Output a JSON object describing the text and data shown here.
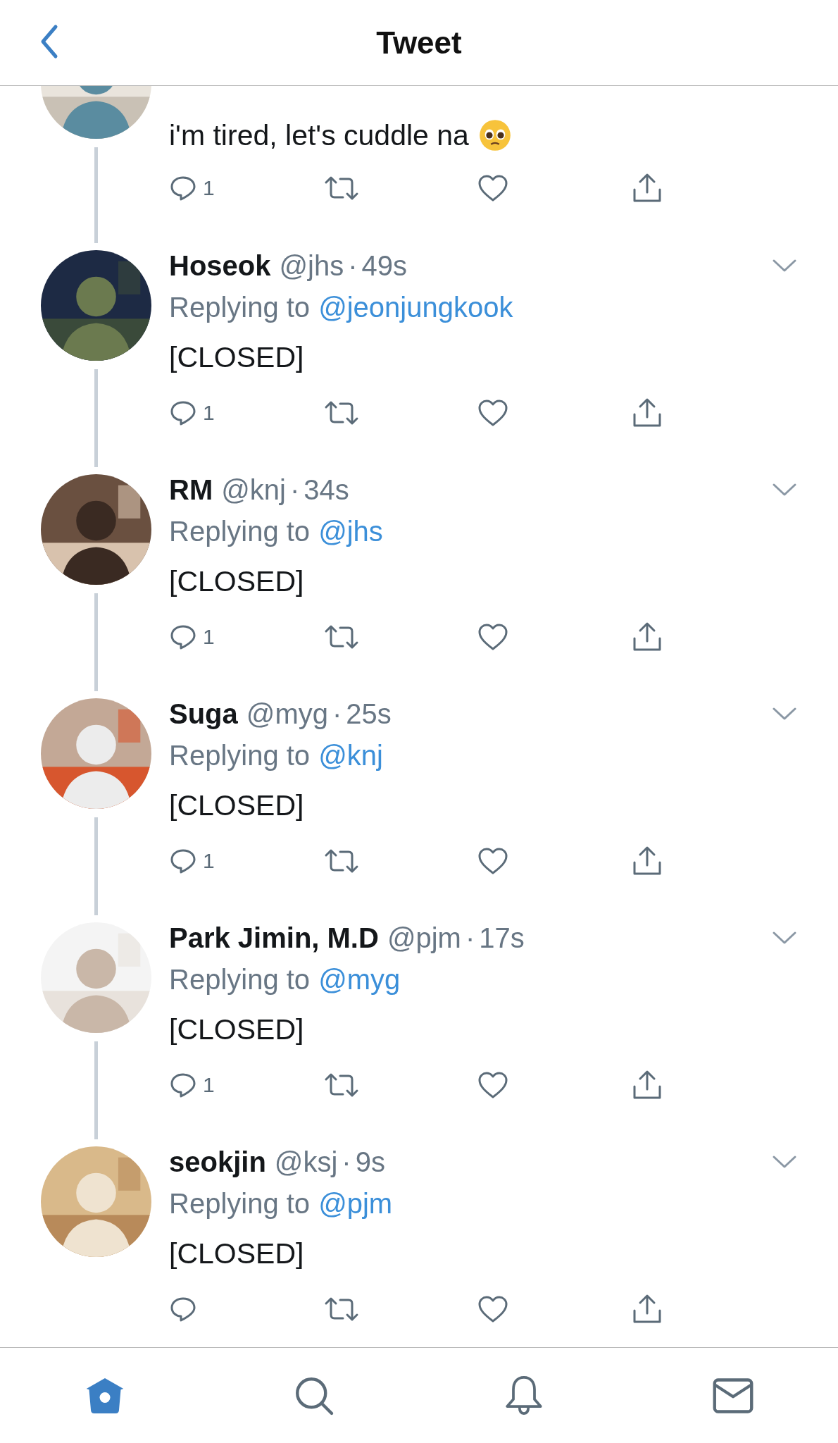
{
  "header": {
    "title": "Tweet"
  },
  "tweets": [
    {
      "body": "i'm tired, let's cuddle na",
      "emoji": true,
      "reply_count": "1"
    },
    {
      "name": "Hoseok",
      "handle": "@jhs",
      "separator": "·",
      "time": "49s",
      "replying_label": "Replying to",
      "replying_to": "@jeonjungkook",
      "body": "[CLOSED]",
      "reply_count": "1"
    },
    {
      "name": "RM",
      "handle": "@knj",
      "separator": "·",
      "time": "34s",
      "replying_label": "Replying to",
      "replying_to": "@jhs",
      "body": "[CLOSED]",
      "reply_count": "1"
    },
    {
      "name": "Suga",
      "handle": "@myg",
      "separator": "·",
      "time": "25s",
      "replying_label": "Replying to",
      "replying_to": "@knj",
      "body": "[CLOSED]",
      "reply_count": "1"
    },
    {
      "name": "Park Jimin, M.D",
      "handle": "@pjm",
      "separator": "·",
      "time": "17s",
      "replying_label": "Replying to",
      "replying_to": "@myg",
      "body": "[CLOSED]",
      "reply_count": "1"
    },
    {
      "name": "seokjin",
      "handle": "@ksj",
      "separator": "·",
      "time": "9s",
      "replying_label": "Replying to",
      "replying_to": "@pjm",
      "body": "[CLOSED]"
    }
  ],
  "nav": [
    {
      "kind": "home",
      "selected": true
    },
    {
      "kind": "search",
      "selected": false
    },
    {
      "kind": "notifications",
      "selected": false
    },
    {
      "kind": "messages",
      "selected": false
    }
  ]
}
